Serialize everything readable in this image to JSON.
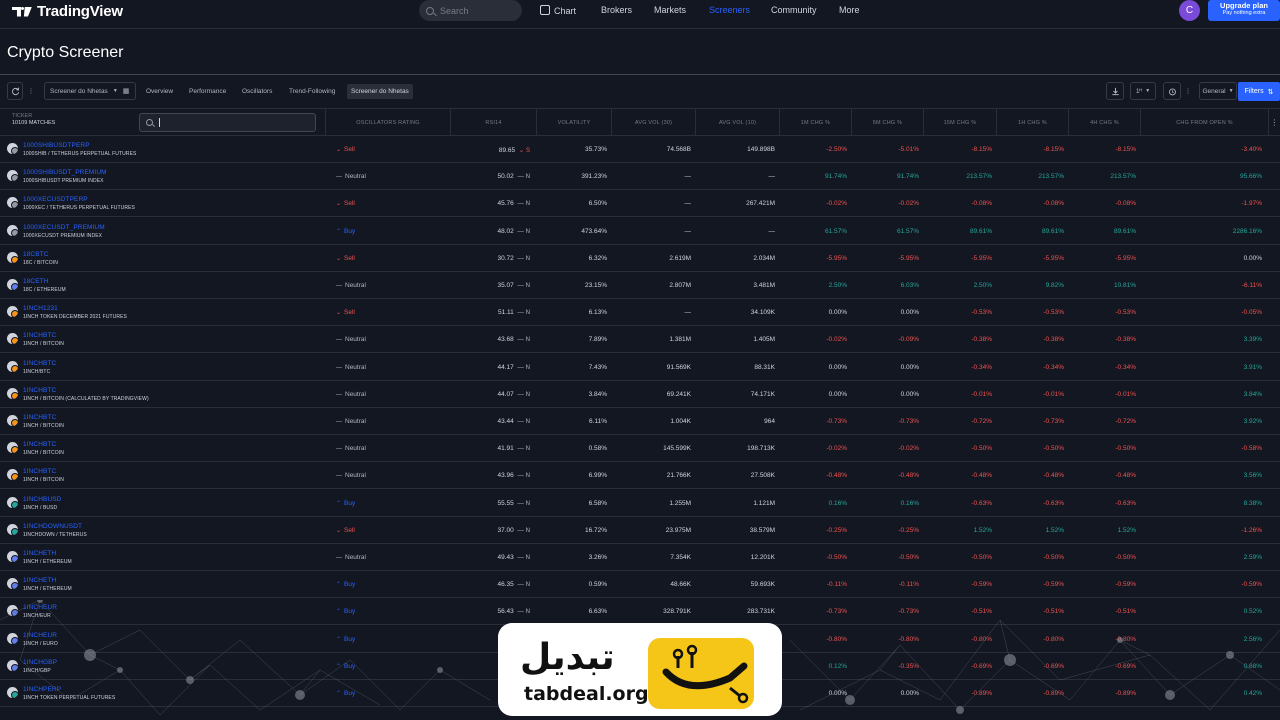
{
  "topnav": {
    "brand": "TradingView",
    "search_placeholder": "Search",
    "links": [
      "Chart",
      "Brokers",
      "Markets",
      "Screeners",
      "Community",
      "More"
    ],
    "active_link": "Screeners",
    "avatar_letter": "C",
    "upgrade_title": "Upgrade plan",
    "upgrade_sub": "Pay nothing extra"
  },
  "page": {
    "title": "Crypto Screener"
  },
  "toolbar": {
    "screen_name": "Screener do Nhetas",
    "tabs": [
      "Overview",
      "Performance",
      "Oscillators",
      "Trend-Following",
      "Screener do Nhetas"
    ],
    "selected_tab": "Screener do Nhetas",
    "interval": "1ᴴ",
    "group": "General",
    "filters_label": "Filters"
  },
  "table": {
    "ticker_label": "TICKER",
    "matches": "10109 MATCHES",
    "search_value": "",
    "columns": [
      "OSCILLATORS RATING",
      "RSI14",
      "VOLATILITY",
      "AVG VOL (30)",
      "AVG VOL (10)",
      "1M CHG %",
      "5M CHG %",
      "15M CHG %",
      "1H CHG %",
      "4H CHG %",
      "CHG FROM OPEN %"
    ],
    "rows": [
      {
        "sym": "1000SHIBUSDTPERP",
        "desc": "1000SHIB / TETHERUS PERPETUAL FUTURES",
        "rating": "Sell",
        "rsi": "89.65",
        "sig": "S",
        "vol": "35.73%",
        "av30": "74.568B",
        "av10": "149.898B",
        "c1": "-2.50%",
        "c5": "-5.01%",
        "c15": "-8.15%",
        "c1h": "-8.15%",
        "c4h": "-8.15%",
        "open": "-3.40%"
      },
      {
        "sym": "1000SHIBUSDT_PREMIUM",
        "desc": "1000SHIBUSDT PREMIUM INDEX",
        "rating": "Neutral",
        "rsi": "50.02",
        "sig": "N",
        "vol": "391.23%",
        "av30": "—",
        "av10": "—",
        "c1": "91.74%",
        "c5": "91.74%",
        "c15": "213.57%",
        "c1h": "213.57%",
        "c4h": "213.57%",
        "open": "95.66%"
      },
      {
        "sym": "1000XECUSDTPERP",
        "desc": "1000XEC / TETHERUS PERPETUAL FUTURES",
        "rating": "Sell",
        "rsi": "45.76",
        "sig": "N",
        "vol": "6.50%",
        "av30": "—",
        "av10": "267.421M",
        "c1": "-0.02%",
        "c5": "-0.02%",
        "c15": "-0.08%",
        "c1h": "-0.08%",
        "c4h": "-0.08%",
        "open": "-1.97%"
      },
      {
        "sym": "1000XECUSDT_PREMIUM",
        "desc": "1000XECUSDT PREMIUM INDEX",
        "rating": "Buy",
        "rsi": "48.02",
        "sig": "N",
        "vol": "473.64%",
        "av30": "—",
        "av10": "—",
        "c1": "61.57%",
        "c5": "61.57%",
        "c15": "89.61%",
        "c1h": "89.61%",
        "c4h": "89.61%",
        "open": "2286.16%"
      },
      {
        "sym": "18CBTC",
        "desc": "18C / BITCOIN",
        "rating": "Sell",
        "rsi": "30.72",
        "sig": "N",
        "vol": "6.32%",
        "av30": "2.619M",
        "av10": "2.034M",
        "c1": "-5.95%",
        "c5": "-5.95%",
        "c15": "-5.95%",
        "c1h": "-5.95%",
        "c4h": "-5.95%",
        "open": "0.00%"
      },
      {
        "sym": "18CETH",
        "desc": "18C / ETHEREUM",
        "rating": "Neutral",
        "rsi": "35.07",
        "sig": "N",
        "vol": "23.15%",
        "av30": "2.807M",
        "av10": "3.481M",
        "c1": "2.50%",
        "c5": "6.03%",
        "c15": "2.50%",
        "c1h": "9.82%",
        "c4h": "10.81%",
        "open": "-6.11%"
      },
      {
        "sym": "1INCH1231",
        "desc": "1INCH TOKEN DECEMBER 2021 FUTURES",
        "rating": "Sell",
        "rsi": "51.11",
        "sig": "N",
        "vol": "6.13%",
        "av30": "—",
        "av10": "34.109K",
        "c1": "0.00%",
        "c5": "0.00%",
        "c15": "-0.53%",
        "c1h": "-0.53%",
        "c4h": "-0.53%",
        "open": "-0.05%"
      },
      {
        "sym": "1INCHBTC",
        "desc": "1INCH / BITCOIN",
        "rating": "Neutral",
        "rsi": "43.68",
        "sig": "N",
        "vol": "7.89%",
        "av30": "1.381M",
        "av10": "1.405M",
        "c1": "-0.02%",
        "c5": "-0.09%",
        "c15": "-0.38%",
        "c1h": "-0.38%",
        "c4h": "-0.38%",
        "open": "3.39%"
      },
      {
        "sym": "1INCHBTC",
        "desc": "1INCH/BTC",
        "rating": "Neutral",
        "rsi": "44.17",
        "sig": "N",
        "vol": "7.43%",
        "av30": "91.569K",
        "av10": "88.31K",
        "c1": "0.00%",
        "c5": "0.00%",
        "c15": "-0.34%",
        "c1h": "-0.34%",
        "c4h": "-0.34%",
        "open": "3.91%"
      },
      {
        "sym": "1INCHBTC",
        "desc": "1INCH / BITCOIN (CALCULATED BY TRADINGVIEW)",
        "rating": "Neutral",
        "rsi": "44.07",
        "sig": "N",
        "vol": "3.84%",
        "av30": "69.241K",
        "av10": "74.171K",
        "c1": "0.00%",
        "c5": "0.00%",
        "c15": "-0.01%",
        "c1h": "-0.01%",
        "c4h": "-0.01%",
        "open": "3.84%"
      },
      {
        "sym": "1INCHBTC",
        "desc": "1INCH / BITCOIN",
        "rating": "Neutral",
        "rsi": "43.44",
        "sig": "N",
        "vol": "6.11%",
        "av30": "1.004K",
        "av10": "964",
        "c1": "-0.73%",
        "c5": "-0.73%",
        "c15": "-0.72%",
        "c1h": "-0.73%",
        "c4h": "-0.72%",
        "open": "3.92%"
      },
      {
        "sym": "1INCHBTC",
        "desc": "1INCH / BITCOIN",
        "rating": "Neutral",
        "rsi": "41.91",
        "sig": "N",
        "vol": "0.58%",
        "av30": "145.599K",
        "av10": "198.713K",
        "c1": "-0.02%",
        "c5": "-0.02%",
        "c15": "-0.50%",
        "c1h": "-0.50%",
        "c4h": "-0.50%",
        "open": "-0.58%"
      },
      {
        "sym": "1INCHBTC",
        "desc": "1INCH / BITCOIN",
        "rating": "Neutral",
        "rsi": "43.96",
        "sig": "N",
        "vol": "6.99%",
        "av30": "21.766K",
        "av10": "27.508K",
        "c1": "-0.48%",
        "c5": "-0.48%",
        "c15": "-0.48%",
        "c1h": "-0.48%",
        "c4h": "-0.48%",
        "open": "3.56%"
      },
      {
        "sym": "1INCHBUSD",
        "desc": "1INCH / BUSD",
        "rating": "Buy",
        "rsi": "55.55",
        "sig": "N",
        "vol": "6.58%",
        "av30": "1.255M",
        "av10": "1.121M",
        "c1": "0.16%",
        "c5": "0.16%",
        "c15": "-0.63%",
        "c1h": "-0.63%",
        "c4h": "-0.63%",
        "open": "8.38%"
      },
      {
        "sym": "1INCHDOWNUSDT",
        "desc": "1INCHDOWN / TETHERUS",
        "rating": "Sell",
        "rsi": "37.00",
        "sig": "N",
        "vol": "16.72%",
        "av30": "23.975M",
        "av10": "38.579M",
        "c1": "-0.25%",
        "c5": "-0.25%",
        "c15": "1.52%",
        "c1h": "1.52%",
        "c4h": "1.52%",
        "open": "-1.26%"
      },
      {
        "sym": "1INCHETH",
        "desc": "1INCH / ETHEREUM",
        "rating": "Neutral",
        "rsi": "49.43",
        "sig": "N",
        "vol": "3.26%",
        "av30": "7.354K",
        "av10": "12.201K",
        "c1": "-0.50%",
        "c5": "-0.50%",
        "c15": "-0.50%",
        "c1h": "-0.50%",
        "c4h": "-0.50%",
        "open": "2.59%"
      },
      {
        "sym": "1INCHETH",
        "desc": "1INCH / ETHEREUM",
        "rating": "Buy",
        "rsi": "46.35",
        "sig": "N",
        "vol": "0.59%",
        "av30": "48.66K",
        "av10": "59.693K",
        "c1": "-0.11%",
        "c5": "-0.11%",
        "c15": "-0.59%",
        "c1h": "-0.59%",
        "c4h": "-0.59%",
        "open": "-0.59%"
      },
      {
        "sym": "1INCHEUR",
        "desc": "1INCH/EUR",
        "rating": "Buy",
        "rsi": "56.43",
        "sig": "N",
        "vol": "6.63%",
        "av30": "328.791K",
        "av10": "283.731K",
        "c1": "-0.73%",
        "c5": "-0.73%",
        "c15": "-0.51%",
        "c1h": "-0.51%",
        "c4h": "-0.51%",
        "open": "0.52%"
      },
      {
        "sym": "1INCHEUR",
        "desc": "1INCH / EURO",
        "rating": "Buy",
        "rsi": "5",
        "sig": "",
        "vol": "",
        "av30": "",
        "av10": "",
        "c1": "-0.80%",
        "c5": "-0.80%",
        "c15": "-0.80%",
        "c1h": "-0.80%",
        "c4h": "-0.80%",
        "open": "2.56%"
      },
      {
        "sym": "1INCHGBP",
        "desc": "1INCH/GBP",
        "rating": "Buy",
        "rsi": "5",
        "sig": "",
        "vol": "",
        "av30": "",
        "av10": "",
        "c1": "0.12%",
        "c5": "-0.35%",
        "c15": "-0.69%",
        "c1h": "-0.69%",
        "c4h": "-0.69%",
        "open": "0.88%"
      },
      {
        "sym": "1INCHPERP",
        "desc": "1INCH TOKEN PERPETUAL FUTURES",
        "rating": "Buy",
        "rsi": "5",
        "sig": "",
        "vol": "",
        "av30": "",
        "av10": "",
        "c1": "0.00%",
        "c5": "0.00%",
        "c15": "-0.89%",
        "c1h": "-0.89%",
        "c4h": "-0.89%",
        "open": "0.42%"
      }
    ]
  },
  "watermark": {
    "fa": "تبدیل",
    "en": "tabdeal.org"
  },
  "colors": {
    "bg": "#131722",
    "accent": "#2962ff",
    "negative": "#ef5350",
    "positive": "#26a69a"
  }
}
